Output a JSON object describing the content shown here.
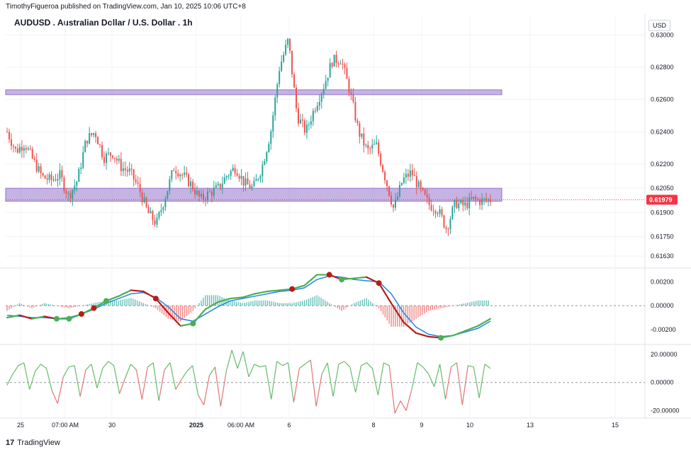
{
  "header": {
    "published": "TimothyFigueroa published on TradingView.com, Jan 10, 2025 10:06 UTC+8",
    "title": "AUDUSD . Australian Dollar / U.S. Dollar . 1h",
    "currency": "USD"
  },
  "footer": {
    "brand": "TradingView",
    "logo_glyph": "17"
  },
  "colors": {
    "up": "#26a69a",
    "down": "#ef5350",
    "zone": "#9575cd",
    "macd_fast": "#1e88e5",
    "macd_green": "#4caf50",
    "macd_red": "#b71c1c",
    "osc_green": "#66bb6a",
    "osc_red": "#e57373",
    "price_tag": "#f23645"
  },
  "time_axis": [
    "25",
    "07:00 AM",
    "30",
    "2025",
    "06:00 AM",
    "6",
    "8",
    "9",
    "10",
    "13",
    "15"
  ],
  "chart_data": [
    {
      "type": "candlestick",
      "symbol": "AUDUSD",
      "interval": "1h",
      "ylim": [
        0.6156,
        0.6312
      ],
      "price_ticks": [
        "0.63000",
        "0.62800",
        "0.62600",
        "0.62400",
        "0.62200",
        "0.62050",
        "0.61900",
        "0.61750",
        "0.61630"
      ],
      "last_price": "0.61979",
      "zones": [
        {
          "from": 0.6263,
          "to": 0.6266
        },
        {
          "from": 0.6197,
          "to": 0.6205
        }
      ],
      "path": [
        0.624,
        0.6228,
        0.6233,
        0.6222,
        0.6212,
        0.621,
        0.6213,
        0.62,
        0.621,
        0.6235,
        0.624,
        0.6224,
        0.6227,
        0.6218,
        0.6215,
        0.6205,
        0.619,
        0.6183,
        0.62,
        0.6218,
        0.6213,
        0.6207,
        0.6198,
        0.6202,
        0.6205,
        0.6213,
        0.6218,
        0.6208,
        0.6205,
        0.6218,
        0.624,
        0.628,
        0.6297,
        0.625,
        0.624,
        0.6255,
        0.6268,
        0.6284,
        0.6285,
        0.6265,
        0.624,
        0.6228,
        0.6232,
        0.6212,
        0.6192,
        0.621,
        0.6215,
        0.6204,
        0.6195,
        0.6192,
        0.618,
        0.6196,
        0.6194,
        0.6198,
        0.6197,
        0.6198
      ]
    },
    {
      "type": "line",
      "name_hidden": true,
      "ylim": [
        -0.0032,
        0.0031
      ],
      "ticks": [
        "0.00200",
        "0.00000",
        "-0.00200"
      ],
      "fast": [
        -0.001,
        -0.0008,
        -0.0011,
        -0.0009,
        -0.0011,
        -0.0011,
        -0.0007,
        -0.0002,
        0.0004,
        0.0008,
        0.0013,
        0.0012,
        0.0006,
        -0.0006,
        -0.0017,
        -0.0015,
        -0.0003,
        0.0003,
        0.0006,
        0.0007,
        0.001,
        0.0012,
        0.0013,
        0.0014,
        0.0017,
        0.0026,
        0.0026,
        0.0022,
        0.0023,
        0.0024,
        0.0019,
        0.0002,
        -0.0014,
        -0.0023,
        -0.0026,
        -0.0027,
        -0.0025,
        -0.0021,
        -0.0017,
        -0.0011
      ],
      "signal": [
        -0.0008,
        -0.0009,
        -0.001,
        -0.001,
        -0.0011,
        -0.001,
        -0.0007,
        -0.0003,
        0.0002,
        0.0006,
        0.001,
        0.0011,
        0.0007,
        -0.0001,
        -0.0011,
        -0.0013,
        -0.0007,
        -0.0001,
        0.0004,
        0.0006,
        0.0008,
        0.001,
        0.0012,
        0.0013,
        0.0015,
        0.0022,
        0.0025,
        0.0024,
        0.0022,
        0.0021,
        0.002,
        0.001,
        -0.0006,
        -0.0018,
        -0.0024,
        -0.0026,
        -0.0025,
        -0.0022,
        -0.0019,
        -0.0013
      ],
      "markers_green": [
        4,
        5,
        8,
        15,
        27,
        35
      ],
      "markers_red": [
        6,
        7,
        12,
        23,
        26,
        30
      ]
    },
    {
      "type": "line",
      "ylim": [
        -0.0248,
        0.0265
      ],
      "ticks": [
        "20.00000",
        "0.00000",
        "-20.00000"
      ],
      "values": [
        -2,
        6,
        12,
        14,
        -5,
        8,
        13,
        10,
        -6,
        -15,
        4,
        11,
        12,
        -10,
        9,
        13,
        -4,
        10,
        15,
        12,
        -8,
        3,
        13,
        9,
        -12,
        11,
        14,
        -13,
        9,
        14,
        -5,
        2,
        8,
        12,
        -9,
        -16,
        5,
        11,
        -17,
        8,
        23,
        10,
        22,
        4,
        13,
        11,
        12,
        -12,
        15,
        12,
        14,
        -14,
        10,
        13,
        16,
        -17,
        6,
        14,
        -10,
        13,
        15,
        11,
        -7,
        12,
        14,
        10,
        -9,
        14,
        12,
        -22,
        -13,
        -20,
        -5,
        14,
        11,
        6,
        -3,
        13,
        -12,
        11,
        14,
        -16,
        12,
        11,
        -11,
        13,
        10
      ]
    }
  ]
}
